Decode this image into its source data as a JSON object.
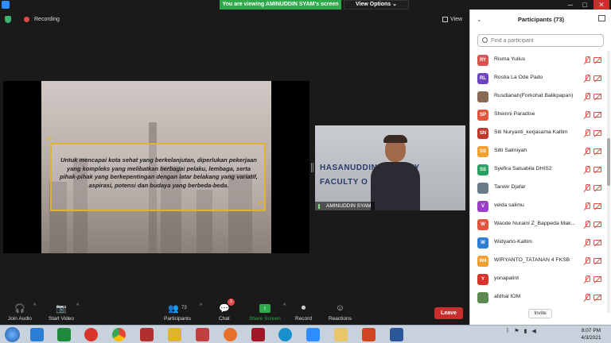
{
  "banner": {
    "text": "You are viewing AMINUDDIN SYAM's screen",
    "view_options": "View Options ⌄"
  },
  "status": {
    "recording": "Recording",
    "view": "View"
  },
  "slide": {
    "quote": "Untuk mencapai kota sehat yang berkelanjutan, diperlukan pekerjaan yang kompleks yang melibatkan berbagai pelaku, lembaga, serta pihak-pihak yang berkepentingan dengan latar belakang yang variatif, aspirasi, potensi dan budaya yang berbeda-beda.",
    "open_mark": "“",
    "close_mark": "”"
  },
  "video": {
    "name": "AMINUDDIN SYAM",
    "wall_line1": "HASANUDDIN U   ERSITY",
    "wall_line2": "FACULTY O       LTH"
  },
  "toolbar": {
    "join_audio": "Join Audio",
    "start_video": "Start Video",
    "participants": "Participants",
    "participants_count": "73",
    "chat": "Chat",
    "chat_badge": "3",
    "share_screen": "Share Screen",
    "record": "Record",
    "reactions": "Reactions",
    "leave": "Leave"
  },
  "panel": {
    "title": "Participants (73)",
    "search_placeholder": "Find a participant",
    "invite": "Invite",
    "participants": [
      {
        "initials": "RY",
        "name": "Risma Yulius",
        "color": "#d9534f"
      },
      {
        "initials": "RL",
        "name": "Rostia La Ode Pado",
        "color": "#6f42c1"
      },
      {
        "initials": "",
        "name": "Rusdianah(Forkohat Balikpapan)",
        "color": "#8a6a55"
      },
      {
        "initials": "SP",
        "name": "Sheinni Paradise",
        "color": "#e0553c"
      },
      {
        "initials": "SN",
        "name": "Siti Nuryanti_kerjasama Kaltim",
        "color": "#c0392b"
      },
      {
        "initials": "SS",
        "name": "Sitti Salmiyah",
        "color": "#f0a030"
      },
      {
        "initials": "SS",
        "name": "Syefira Salsabila DHIS2",
        "color": "#28a060"
      },
      {
        "initials": "",
        "name": "Tanwir Djafar",
        "color": "#6a7a88"
      },
      {
        "initials": "V",
        "name": "velda salimu",
        "color": "#9b3fc4"
      },
      {
        "initials": "W",
        "name": "Waode Nuraini Z_Bappeda Mak...",
        "color": "#e0553c"
      },
      {
        "initials": "W",
        "name": "Widyarto-Kaltim",
        "color": "#2d7fd6"
      },
      {
        "initials": "W4",
        "name": "WIRYANTO_TATANAN 4 FKSB",
        "color": "#f0a030"
      },
      {
        "initials": "Y",
        "name": "yonapalint",
        "color": "#d9342c"
      },
      {
        "initials": "",
        "name": "afdhal IOM",
        "color": "#5a8a50"
      }
    ]
  },
  "taskbar": {
    "time": "8:07 PM",
    "date": "4/3/2021"
  }
}
